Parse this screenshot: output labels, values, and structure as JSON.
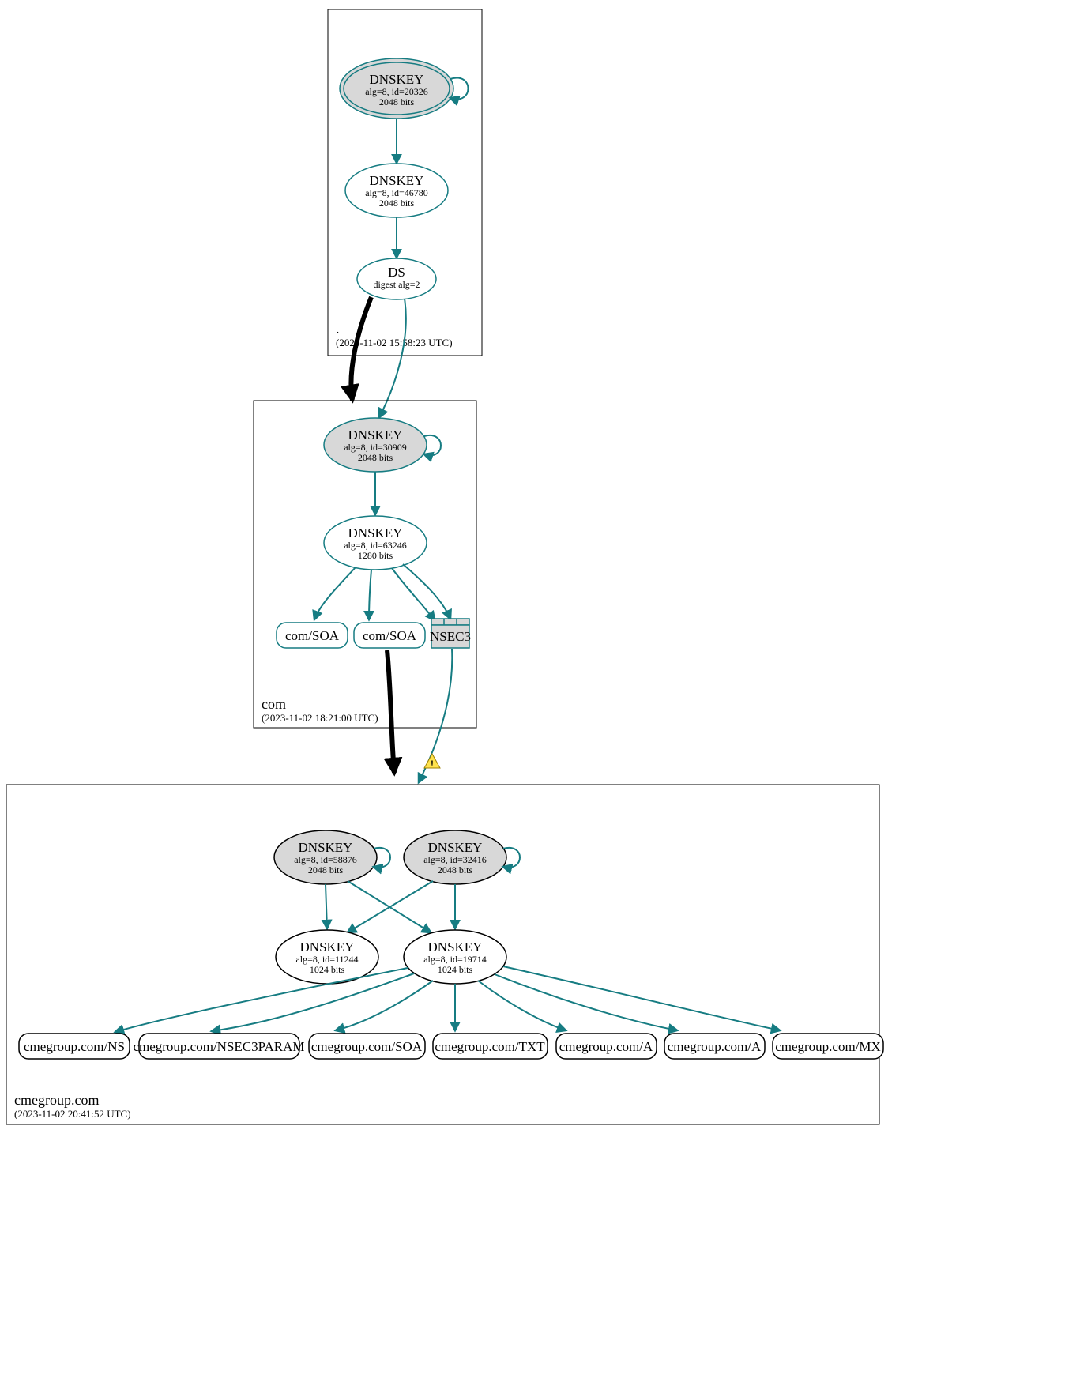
{
  "zones": {
    "root": {
      "name": ".",
      "timestamp": "(2023-11-02 15:58:23 UTC)"
    },
    "com": {
      "name": "com",
      "timestamp": "(2023-11-02 18:21:00 UTC)"
    },
    "cme": {
      "name": "cmegroup.com",
      "timestamp": "(2023-11-02 20:41:52 UTC)"
    }
  },
  "nodes": {
    "root_ksk": {
      "title": "DNSKEY",
      "sub1": "alg=8, id=20326",
      "sub2": "2048 bits"
    },
    "root_zsk": {
      "title": "DNSKEY",
      "sub1": "alg=8, id=46780",
      "sub2": "2048 bits"
    },
    "root_ds": {
      "title": "DS",
      "sub1": "digest alg=2"
    },
    "com_ksk": {
      "title": "DNSKEY",
      "sub1": "alg=8, id=30909",
      "sub2": "2048 bits"
    },
    "com_zsk": {
      "title": "DNSKEY",
      "sub1": "alg=8, id=63246",
      "sub2": "1280 bits"
    },
    "cme_ksk1": {
      "title": "DNSKEY",
      "sub1": "alg=8, id=58876",
      "sub2": "2048 bits"
    },
    "cme_ksk2": {
      "title": "DNSKEY",
      "sub1": "alg=8, id=32416",
      "sub2": "2048 bits"
    },
    "cme_zsk1": {
      "title": "DNSKEY",
      "sub1": "alg=8, id=11244",
      "sub2": "1024 bits"
    },
    "cme_zsk2": {
      "title": "DNSKEY",
      "sub1": "alg=8, id=19714",
      "sub2": "1024 bits"
    }
  },
  "records": {
    "com_soa1": "com/SOA",
    "com_soa2": "com/SOA",
    "nsec3": "NSEC3",
    "cme_ns": "cmegroup.com/NS",
    "cme_nsec3": "cmegroup.com/NSEC3PARAM",
    "cme_soa": "cmegroup.com/SOA",
    "cme_txt": "cmegroup.com/TXT",
    "cme_a1": "cmegroup.com/A",
    "cme_a2": "cmegroup.com/A",
    "cme_mx": "cmegroup.com/MX"
  }
}
